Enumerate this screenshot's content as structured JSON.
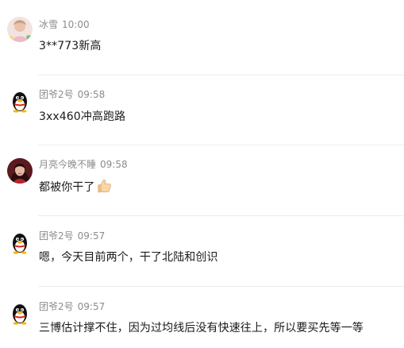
{
  "messages": [
    {
      "name": "冰雪",
      "time": "10:00",
      "text": "3**773新高",
      "avatar": "photo-avatar-icon"
    },
    {
      "name": "团爷2号",
      "time": "09:58",
      "text": "3xx460冲高跑路",
      "avatar": "qq-penguin-icon"
    },
    {
      "name": "月亮今晚不睡",
      "time": "09:58",
      "text": "都被你干了",
      "emoji": "thumbs-up-icon",
      "avatar": "photo-avatar-icon"
    },
    {
      "name": "团爷2号",
      "time": "09:57",
      "text": "嗯，今天目前两个，干了北陆和创识",
      "avatar": "qq-penguin-icon"
    },
    {
      "name": "团爷2号",
      "time": "09:57",
      "text": "三博估计撑不住，因为过均线后没有快速往上，所以要买先等一等",
      "avatar": "qq-penguin-icon"
    }
  ],
  "colors": {
    "meta_text": "#8c8c8c",
    "body_text": "#1a1a1a",
    "divider": "#ececec"
  }
}
